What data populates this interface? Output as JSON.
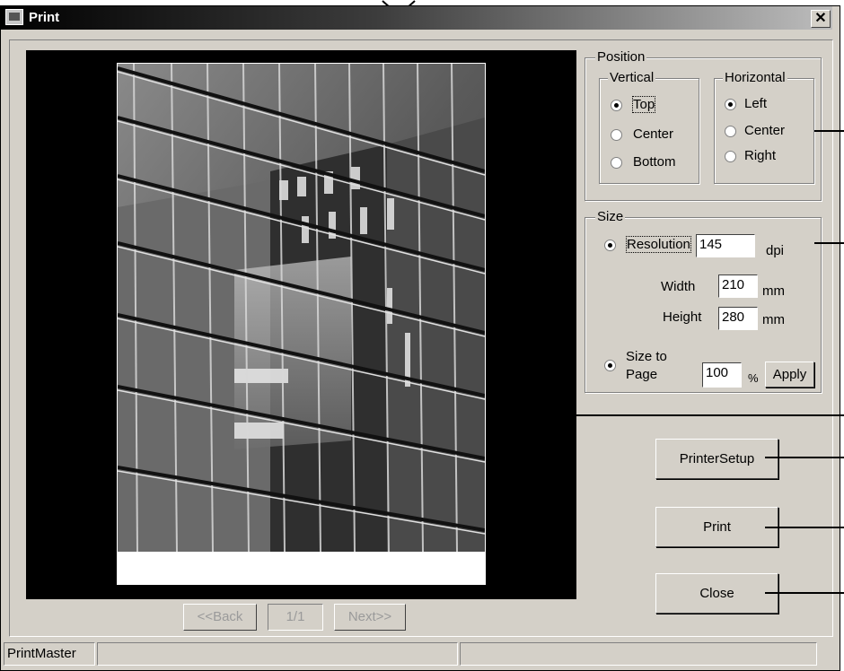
{
  "window": {
    "title": "Print",
    "close_glyph": "✕"
  },
  "preview": {
    "photo_description_icon": "photo-building-reflection"
  },
  "pager": {
    "back_label": "<<Back",
    "page_indicator": "1/1",
    "next_label": "Next>>"
  },
  "position": {
    "legend": "Position",
    "vertical": {
      "legend": "Vertical",
      "options": [
        "Top",
        "Center",
        "Bottom"
      ],
      "selected": "Top"
    },
    "horizontal": {
      "legend": "Horizontal",
      "options": [
        "Left",
        "Center",
        "Right"
      ],
      "selected": "Left"
    }
  },
  "size": {
    "legend": "Size",
    "resolution_label": "Resolution",
    "resolution_value": "145",
    "resolution_unit": "dpi",
    "width_label": "Width",
    "width_value": "210",
    "width_unit": "mm",
    "height_label": "Height",
    "height_value": "280",
    "height_unit": "mm",
    "size_to_page_label_1": "Size to",
    "size_to_page_label_2": "Page",
    "percent_value": "100",
    "percent_unit": "%",
    "apply_label": "Apply"
  },
  "buttons": {
    "printer_setup": "PrinterSetup",
    "print": "Print",
    "close": "Close"
  },
  "statusbar": {
    "app_name": "PrintMaster"
  }
}
